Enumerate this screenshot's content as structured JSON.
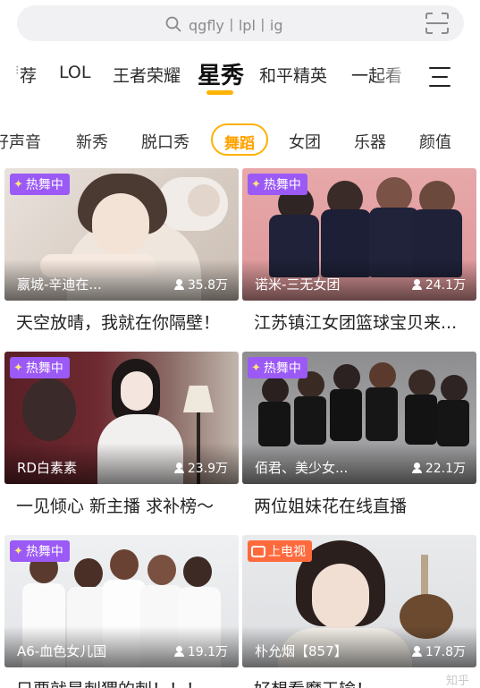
{
  "search": {
    "placeholder": "qgfly丨lpl丨ig",
    "icon": "search-icon",
    "scan_icon": "scan-icon"
  },
  "top_nav": {
    "items": [
      "荐",
      "LOL",
      "王者荣耀",
      "星秀",
      "和平精英",
      "一起看"
    ],
    "active": "星秀",
    "accent": "#ffb400",
    "menu_icon": "menu-icon"
  },
  "sub_nav": {
    "items": [
      "好声音",
      "新秀",
      "脱口秀",
      "舞蹈",
      "女团",
      "乐器",
      "颜值"
    ],
    "active": "舞蹈",
    "accent": "#ffa200"
  },
  "cards": [
    {
      "badge": "热舞中",
      "badge_type": "dance",
      "streamer": "嬴城-辛迪在...",
      "viewers": "35.8万",
      "title": "天空放晴，我就在你隔壁！"
    },
    {
      "badge": "热舞中",
      "badge_type": "dance",
      "streamer": "诺米-三无女团",
      "viewers": "24.1万",
      "title": "江苏镇江女团篮球宝贝来..."
    },
    {
      "badge": "热舞中",
      "badge_type": "dance",
      "streamer": "RD白素素",
      "viewers": "23.9万",
      "title": "一见倾心 新主播 求补榜～"
    },
    {
      "badge": "热舞中",
      "badge_type": "dance",
      "streamer": "佰君、美少女...",
      "viewers": "22.1万",
      "title": "两位姐妹花在线直播"
    },
    {
      "badge": "热舞中",
      "badge_type": "dance",
      "streamer": "A6-血色女儿国",
      "viewers": "19.1万",
      "title": "只要就是刺猬的刺！！！"
    },
    {
      "badge": "上电视",
      "badge_type": "tv",
      "streamer": "朴允烟【857】",
      "viewers": "17.8万",
      "title": "好想看魔王输！"
    }
  ],
  "colors": {
    "dance_badge": "#9b59f6",
    "tv_badge": "#ff6a3d"
  },
  "watermark": "知乎"
}
